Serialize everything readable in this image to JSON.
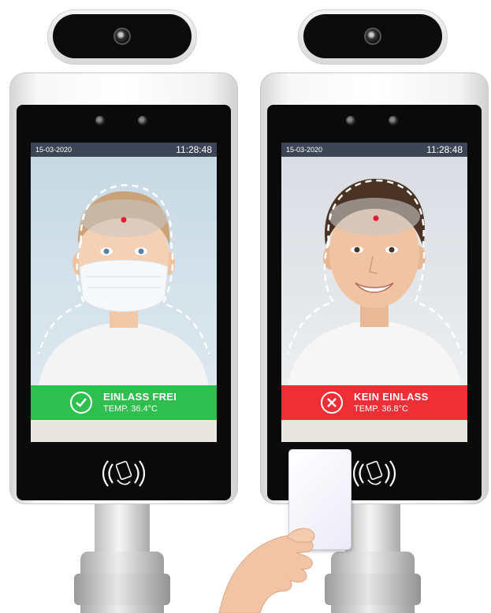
{
  "devices": [
    {
      "id": "left",
      "date": "15-03-2020",
      "time": "11:28:48",
      "result_title": "EINLASS FREI",
      "result_temp": "TEMP. 36.4°C",
      "status": "granted",
      "banner_color": "#2fbf4f",
      "icon": "check-circle-icon"
    },
    {
      "id": "right",
      "date": "15-03-2020",
      "time": "11:28:48",
      "result_title": "KEIN EINLASS",
      "result_temp": "TEMP. 36.8°C",
      "status": "denied",
      "banner_color": "#ef2f36",
      "icon": "x-circle-icon"
    }
  ],
  "colors": {
    "device_face": "#0a0a0a",
    "frame": "#f2f2f2",
    "temp_point": "#e8192c"
  }
}
